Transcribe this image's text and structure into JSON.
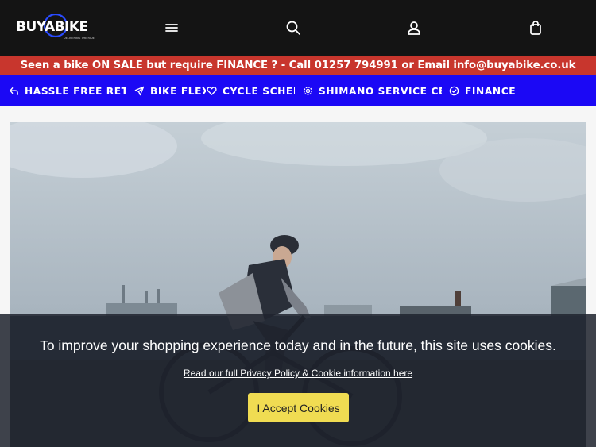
{
  "header": {
    "logo_text": "BUYABIKE",
    "logo_tagline": "DELIVERING THE RIDE",
    "icons": [
      "menu-icon",
      "search-icon",
      "account-icon",
      "bag-icon"
    ]
  },
  "promo": {
    "text": "Seen a bike ON SALE but require FINANCE ? - Call 01257 794991 or Email info@buyabike.co.uk"
  },
  "nav": {
    "items": [
      {
        "label": "HASSLE FREE RETURNS",
        "icon": "return-arrow-icon"
      },
      {
        "label": "BIKE FLEX",
        "icon": "send-icon"
      },
      {
        "label": "CYCLE SCHEME",
        "icon": "heart-icon"
      },
      {
        "label": "SHIMANO SERVICE CENTRE",
        "icon": "gear-icon"
      },
      {
        "label": "FINANCE",
        "icon": "check-circle-icon"
      }
    ]
  },
  "cookie": {
    "message": "To improve your shopping experience today and in the future, this site uses cookies.",
    "link": "Read our full Privacy Policy & Cookie information here",
    "accept_label": "I Accept Cookies"
  },
  "colors": {
    "header_bg": "#141414",
    "promo_bg": "#c8362d",
    "nav_bg": "#1b08f5",
    "accept_bg": "#f0dc52",
    "logo_accent": "#2a4bff"
  }
}
